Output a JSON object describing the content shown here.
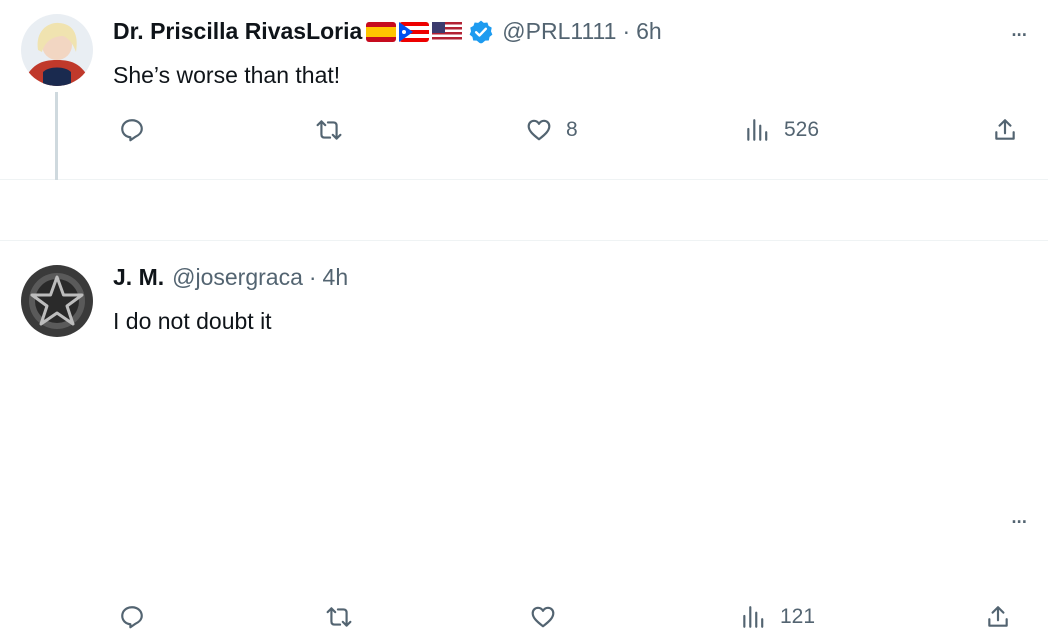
{
  "colors": {
    "text": "#0f1419",
    "muted": "#536471",
    "verified": "#1d9bf0",
    "line": "#cfd9de"
  },
  "tweets": [
    {
      "name": "Dr. Priscilla RivasLoria",
      "flags": [
        "spain-flag-icon",
        "puerto-rico-flag-icon",
        "usa-flag-icon"
      ],
      "verified": true,
      "handle": "@PRL1111",
      "separator": "·",
      "time": "6h",
      "text": "She’s worse than that!",
      "more": "...",
      "actions": {
        "reply": "",
        "retweet": "",
        "like": "8",
        "views": "526",
        "share": ""
      }
    },
    {
      "name": "J. M.",
      "handle": "@josergraca",
      "separator": "·",
      "time": "4h",
      "text": "I do not doubt it",
      "more": "...",
      "actions": {
        "reply": "",
        "retweet": "",
        "like": "",
        "views": "121",
        "share": ""
      }
    }
  ]
}
